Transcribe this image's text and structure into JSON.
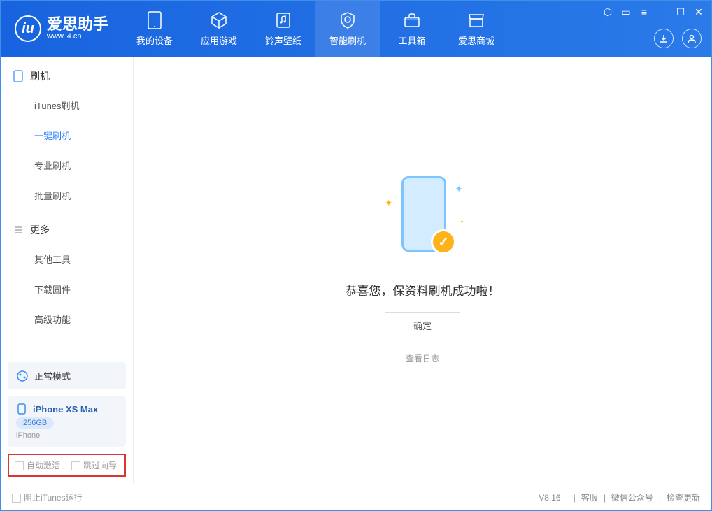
{
  "app": {
    "name": "爱思助手",
    "url": "www.i4.cn"
  },
  "tabs": [
    {
      "label": "我的设备"
    },
    {
      "label": "应用游戏"
    },
    {
      "label": "铃声壁纸"
    },
    {
      "label": "智能刷机"
    },
    {
      "label": "工具箱"
    },
    {
      "label": "爱思商城"
    }
  ],
  "sidebar": {
    "section1": {
      "title": "刷机",
      "items": [
        "iTunes刷机",
        "一键刷机",
        "专业刷机",
        "批量刷机"
      ]
    },
    "section2": {
      "title": "更多",
      "items": [
        "其他工具",
        "下载固件",
        "高级功能"
      ]
    }
  },
  "mode_panel": {
    "label": "正常模式"
  },
  "device": {
    "name": "iPhone XS Max",
    "capacity": "256GB",
    "type": "iPhone"
  },
  "checks": {
    "auto_activate": "自动激活",
    "skip_wizard": "跳过向导"
  },
  "main": {
    "message": "恭喜您，保资料刷机成功啦！",
    "ok": "确定",
    "view_log": "查看日志"
  },
  "footer": {
    "block_itunes": "阻止iTunes运行",
    "version": "V8.16",
    "support": "客服",
    "wechat": "微信公众号",
    "update": "检查更新"
  }
}
